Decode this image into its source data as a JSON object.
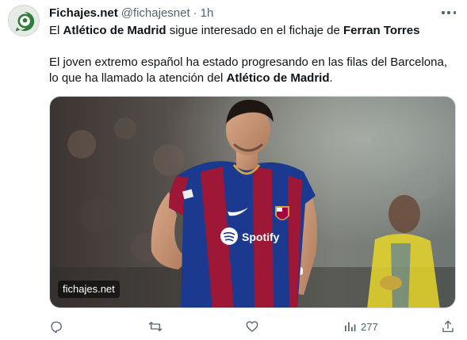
{
  "tweet": {
    "author_name": "Fichajes.net",
    "handle": "@fichajesnet",
    "separator": "·",
    "time": "1h",
    "line1": [
      {
        "t": "El ",
        "b": false
      },
      {
        "t": "Atlético de Madrid",
        "b": true
      },
      {
        "t": " sigue interesado en el fichaje de ",
        "b": false
      },
      {
        "t": "Ferran Torres",
        "b": true
      }
    ],
    "line2": [
      {
        "t": "El joven extremo español ha estado progresando en las filas del Barcelona,",
        "b": false
      }
    ],
    "line3": [
      {
        "t": "lo que ha llamado la atención del ",
        "b": false
      },
      {
        "t": "Atlético de Madrid",
        "b": true
      },
      {
        "t": ".",
        "b": false
      }
    ],
    "media": {
      "watermark": "fichajes.net",
      "jersey_sponsor": "Spotify"
    },
    "actions": {
      "reply_icon": "reply-icon",
      "retweet_icon": "retweet-icon",
      "like_icon": "heart-icon",
      "views_icon": "views-icon",
      "views_count": "277",
      "share_icon": "share-icon"
    }
  },
  "colors": {
    "text": "#0f1419",
    "secondary": "#536471",
    "border": "#cfd9de",
    "jersey_blue": "#1b3a8f",
    "jersey_red": "#9e1737",
    "keeper_yellow": "#e8d62a"
  }
}
